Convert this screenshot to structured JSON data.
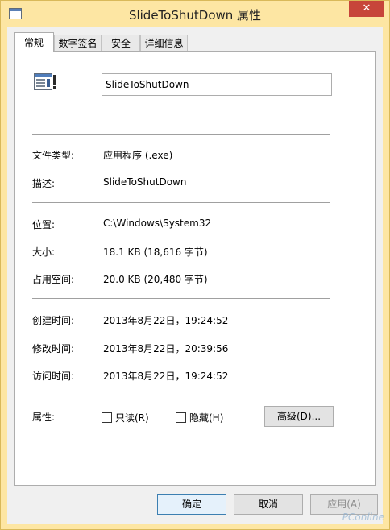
{
  "window": {
    "title": "SlideToShutDown 属性",
    "close_glyph": "✕"
  },
  "tabs": [
    {
      "label": "常规",
      "active": true
    },
    {
      "label": "数字签名"
    },
    {
      "label": "安全"
    },
    {
      "label": "详细信息"
    }
  ],
  "general": {
    "file_name": "SlideToShutDown",
    "file_icon": "application-window-icon",
    "type_label": "文件类型:",
    "type_value": "应用程序 (.exe)",
    "desc_label": "描述:",
    "desc_value": "SlideToShutDown",
    "location_label": "位置:",
    "location_value": "C:\\Windows\\System32",
    "size_label": "大小:",
    "size_value": "18.1 KB (18,616 字节)",
    "disk_label": "占用空间:",
    "disk_value": "20.0 KB (20,480 字节)",
    "created_label": "创建时间:",
    "created_value": "2013年8月22日，19:24:52",
    "modified_label": "修改时间:",
    "modified_value": "2013年8月22日，20:39:56",
    "accessed_label": "访问时间:",
    "accessed_value": "2013年8月22日，19:24:52",
    "attr_label": "属性:",
    "readonly_label": "只读(R)",
    "readonly_checked": false,
    "hidden_label": "隐藏(H)",
    "hidden_checked": false,
    "advanced_label": "高级(D)..."
  },
  "footer": {
    "ok_label": "确定",
    "cancel_label": "取消",
    "apply_label": "应用(A)"
  },
  "watermark": "PConline"
}
